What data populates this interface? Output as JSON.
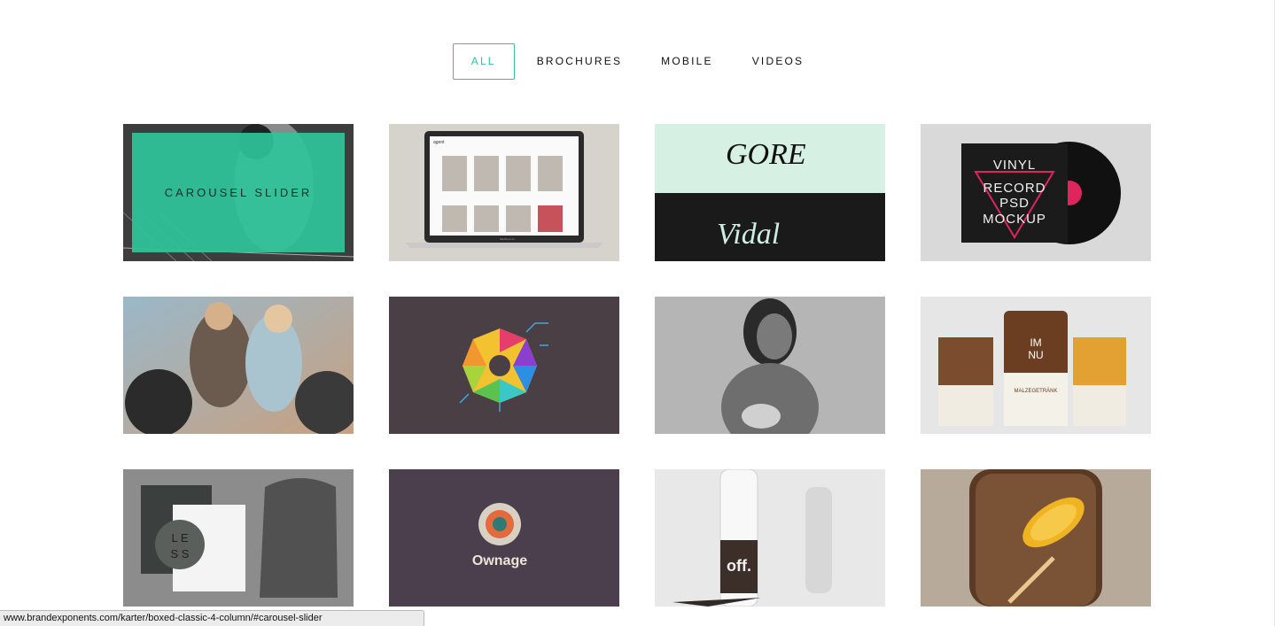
{
  "filters": {
    "all": "ALL",
    "brochures": "BROCHURES",
    "mobile": "MOBILE",
    "videos": "VIDEOS"
  },
  "accent_color": "#2fc49a",
  "tiles": {
    "carousel": {
      "overlay_label": "CAROUSEL SLIDER"
    },
    "laptop": {
      "nav_brand": "agent",
      "caption": "MacBook Air"
    },
    "lettering": {
      "top_word": "GORE",
      "bottom_word": "Vidal"
    },
    "vinyl": {
      "line1": "VINYL",
      "line2": "RECORD",
      "line3": "PSD",
      "line4": "MOCKUP"
    },
    "packaging": {
      "brand_top": "IM",
      "brand_bottom": "NU",
      "product_label": "MALZEGETRÄNK"
    },
    "tshirt": {
      "word_top": "L E",
      "word_bottom": "S S"
    },
    "ownage": {
      "brand": "Ownage"
    },
    "bottle": {
      "brand": "off."
    }
  },
  "status_bar": {
    "url": "www.brandexponents.com/karter/boxed-classic-4-column/#carousel-slider"
  }
}
